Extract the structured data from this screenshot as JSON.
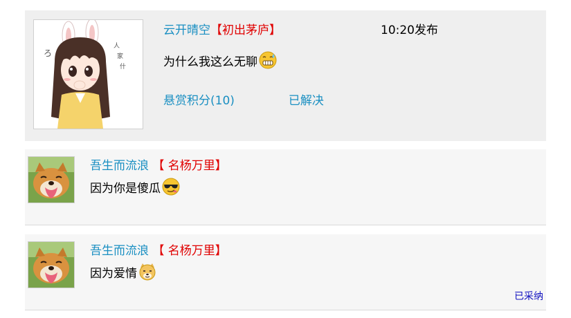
{
  "question": {
    "username": "云开晴空",
    "rank": "【初出茅庐】",
    "time": "10:20发布",
    "text": "为什么我这么无聊",
    "text_emoji": "grimace-sweat-face-icon",
    "reward": "悬赏积分(10)",
    "status": "已解决"
  },
  "answers": [
    {
      "username": "吾生而流浪",
      "rank": "【 名杨万里】",
      "text": "因为你是傻瓜",
      "emoji": "sunglasses-face-icon"
    },
    {
      "username": "吾生而流浪",
      "rank": "【 名杨万里】",
      "text": "因为爱情",
      "emoji": "doge-icon",
      "adopted_label": "已采纳"
    }
  ],
  "colors": {
    "link": "#1a8fc2",
    "rank": "#e00000",
    "adopted": "#1010c0"
  }
}
